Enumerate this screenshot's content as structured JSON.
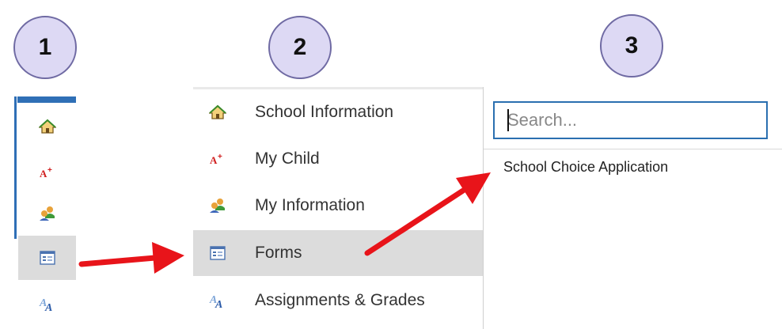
{
  "steps": [
    "1",
    "2",
    "3"
  ],
  "menu": {
    "items": [
      {
        "label": "School Information",
        "icon": "home-icon"
      },
      {
        "label": "My Child",
        "icon": "grade-icon"
      },
      {
        "label": "My Information",
        "icon": "people-icon"
      },
      {
        "label": "Forms",
        "icon": "form-icon"
      },
      {
        "label": "Assignments & Grades",
        "icon": "assignments-icon"
      }
    ],
    "active_index": 3
  },
  "forms_panel": {
    "search_placeholder": "Search...",
    "items": [
      "School Choice Application"
    ]
  },
  "colors": {
    "step_circle_fill": "#ddd9f4",
    "step_circle_border": "#6f6aa3",
    "active_item_bg": "#dcdcdc",
    "accent_blue": "#2f6fb6",
    "arrow_red": "#e8141a"
  }
}
